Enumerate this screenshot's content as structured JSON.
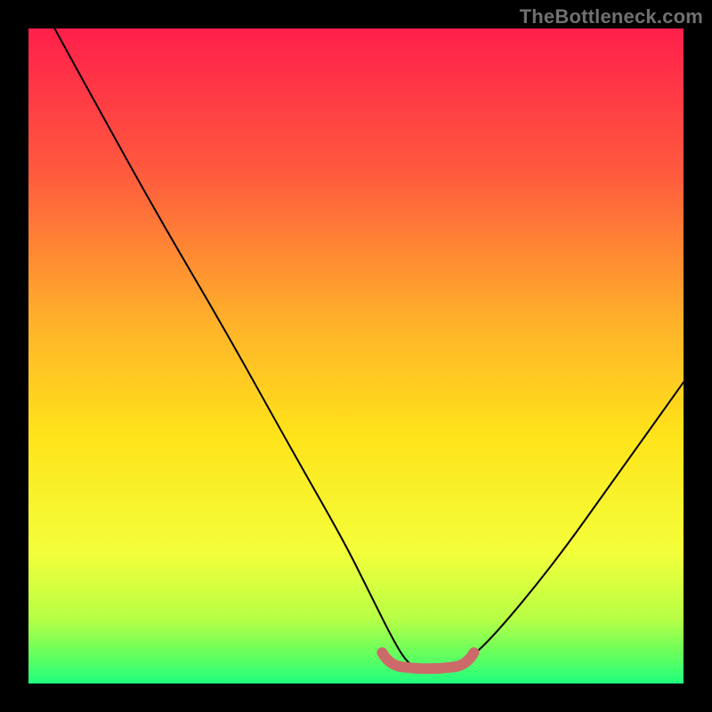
{
  "watermark": "TheBottleneck.com",
  "colors": {
    "gradient_top": "#ff1f4b",
    "gradient_mid_upper": "#ff7a3a",
    "gradient_mid": "#ffd400",
    "gradient_lower": "#f6ff4a",
    "gradient_bottom1": "#9bff52",
    "gradient_bottom2": "#1fff80",
    "curve": "#000000",
    "valley_marker": "#cc6a6a",
    "border": "#000000"
  },
  "chart_data": {
    "type": "line",
    "title": "",
    "xlabel": "",
    "ylabel": "",
    "xlim": [
      0,
      100
    ],
    "ylim": [
      0,
      100
    ],
    "series": [
      {
        "name": "bottleneck-curve",
        "x": [
          4,
          10,
          20,
          30,
          40,
          48,
          52,
          56,
          58,
          60,
          62,
          66,
          70,
          80,
          90,
          100
        ],
        "y": [
          100,
          89,
          71,
          54,
          36,
          22,
          14,
          6,
          3,
          2,
          2,
          3,
          6,
          18,
          32,
          46
        ]
      }
    ],
    "annotations": [
      {
        "name": "optimal-range",
        "x_start": 54,
        "x_end": 68,
        "y": 2
      }
    ]
  }
}
